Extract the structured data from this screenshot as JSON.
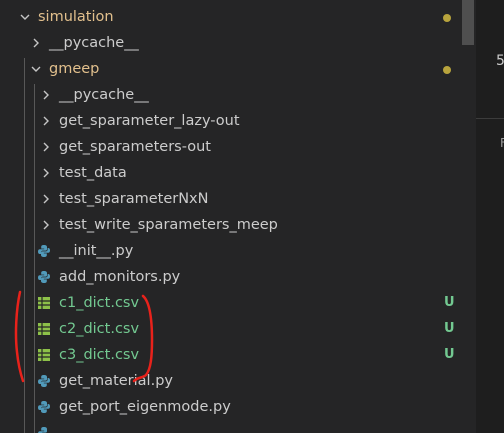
{
  "colors": {
    "folder_label": "#cccccc",
    "modified_folder": "#e2c08d",
    "untracked_file": "#73c991",
    "python_icon": "#519aba",
    "csv_icon": "#8dc149",
    "modified_dot": "#b8a43d",
    "annotation": "#e8221b"
  },
  "tree": {
    "root": {
      "label": "simulation",
      "icon": "chevron-down-icon"
    },
    "pycache_top": {
      "label": "__pycache__",
      "icon": "chevron-right-icon"
    },
    "gmeep": {
      "label": "gmeep",
      "icon": "chevron-down-icon"
    },
    "folders": [
      {
        "label": "__pycache__"
      },
      {
        "label": "get_sparameter_lazy-out"
      },
      {
        "label": "get_sparameters-out"
      },
      {
        "label": "test_data"
      },
      {
        "label": "test_sparameterNxN"
      },
      {
        "label": "test_write_sparameters_meep"
      }
    ],
    "files": [
      {
        "label": "__init__.py",
        "icon": "python-icon",
        "badge": ""
      },
      {
        "label": "add_monitors.py",
        "icon": "python-icon",
        "badge": ""
      },
      {
        "label": "c1_dict.csv",
        "icon": "csv-icon",
        "badge": "U"
      },
      {
        "label": "c2_dict.csv",
        "icon": "csv-icon",
        "badge": "U"
      },
      {
        "label": "c3_dict.csv",
        "icon": "csv-icon",
        "badge": "U"
      },
      {
        "label": "get_material.py",
        "icon": "python-icon",
        "badge": ""
      },
      {
        "label": "get_port_eigenmode.py",
        "icon": "python-icon",
        "badge": ""
      }
    ]
  },
  "right_pane": {
    "text_1": "5",
    "text_2": "F"
  }
}
